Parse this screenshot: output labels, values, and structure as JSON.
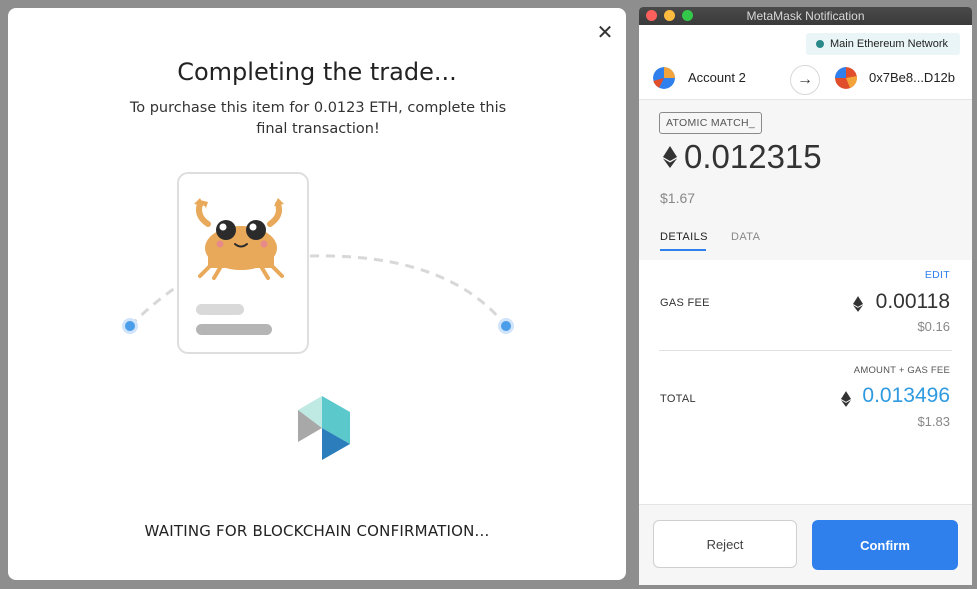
{
  "modal": {
    "close_glyph": "✕",
    "title": "Completing the trade...",
    "subtitle": "To purchase this item for 0.0123 ETH, complete this final transaction!",
    "status": "WAITING FOR BLOCKCHAIN CONFIRMATION..."
  },
  "metamask": {
    "window_title": "MetaMask Notification",
    "network": "Main Ethereum Network",
    "from_account": "Account 2",
    "arrow_glyph": "→",
    "to_address": "0x7Be8...D12b",
    "method": "ATOMIC MATCH_",
    "amount_eth": "0.012315",
    "amount_fiat": "$1.67",
    "tabs": {
      "details": "DETAILS",
      "data": "DATA"
    },
    "edit_label": "EDIT",
    "gas_fee": {
      "label": "GAS FEE",
      "eth": "0.00118",
      "fiat": "$0.16"
    },
    "amount_plus_gas_label": "AMOUNT + GAS FEE",
    "total": {
      "label": "TOTAL",
      "eth": "0.013496",
      "fiat": "$1.83"
    },
    "buttons": {
      "reject": "Reject",
      "confirm": "Confirm"
    }
  },
  "colors": {
    "accent_blue": "#2f80ed",
    "total_blue": "#2f9ae0",
    "network_dot": "#2a8a8a",
    "crab_orange": "#e8a95a",
    "node_blue": "#4a9de8"
  },
  "icons": {
    "close": "close-icon",
    "eth": "ethereum-diamond-icon",
    "logo": "opensea-cube-logo",
    "item": "crab-cryptokitty-illustration"
  }
}
